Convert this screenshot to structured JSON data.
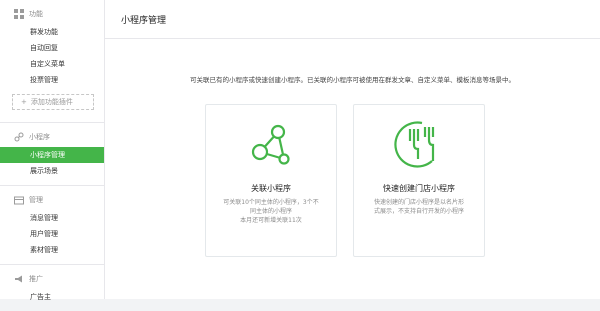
{
  "sidebar": {
    "sections": [
      {
        "title": "功能",
        "icon": "grid-icon",
        "items": [
          "群发功能",
          "自动回复",
          "自定义菜单",
          "投票管理"
        ],
        "add_label": "添加功能插件"
      },
      {
        "title": "小程序",
        "icon": "link-icon",
        "items": [
          "小程序管理",
          "展示场景"
        ],
        "active": "小程序管理"
      },
      {
        "title": "管理",
        "icon": "folder-icon",
        "items": [
          "消息管理",
          "用户管理",
          "素材管理"
        ]
      },
      {
        "title": "推广",
        "icon": "megaphone-icon",
        "items": [
          "广告主"
        ]
      }
    ]
  },
  "main": {
    "title": "小程序管理",
    "intro": "可关联已有的小程序或快速创建小程序。已关联的小程序可被使用在群发文章、自定义菜单、模板消息等场景中。",
    "cards": [
      {
        "title": "关联小程序",
        "icon": "network-icon",
        "desc": [
          "可关联10个同主体的小程序，3个不",
          "同主体的小程序",
          "本月还可新增关联11次"
        ]
      },
      {
        "title": "快速创建门店小程序",
        "icon": "food-icon",
        "desc": [
          "快速创建的门店小程序是以名片形",
          "式展示，不支持自行开发的小程序"
        ]
      }
    ]
  },
  "colors": {
    "accent": "#44b549",
    "sidebar_bg": "#ffffff",
    "border": "#e7e7eb"
  }
}
